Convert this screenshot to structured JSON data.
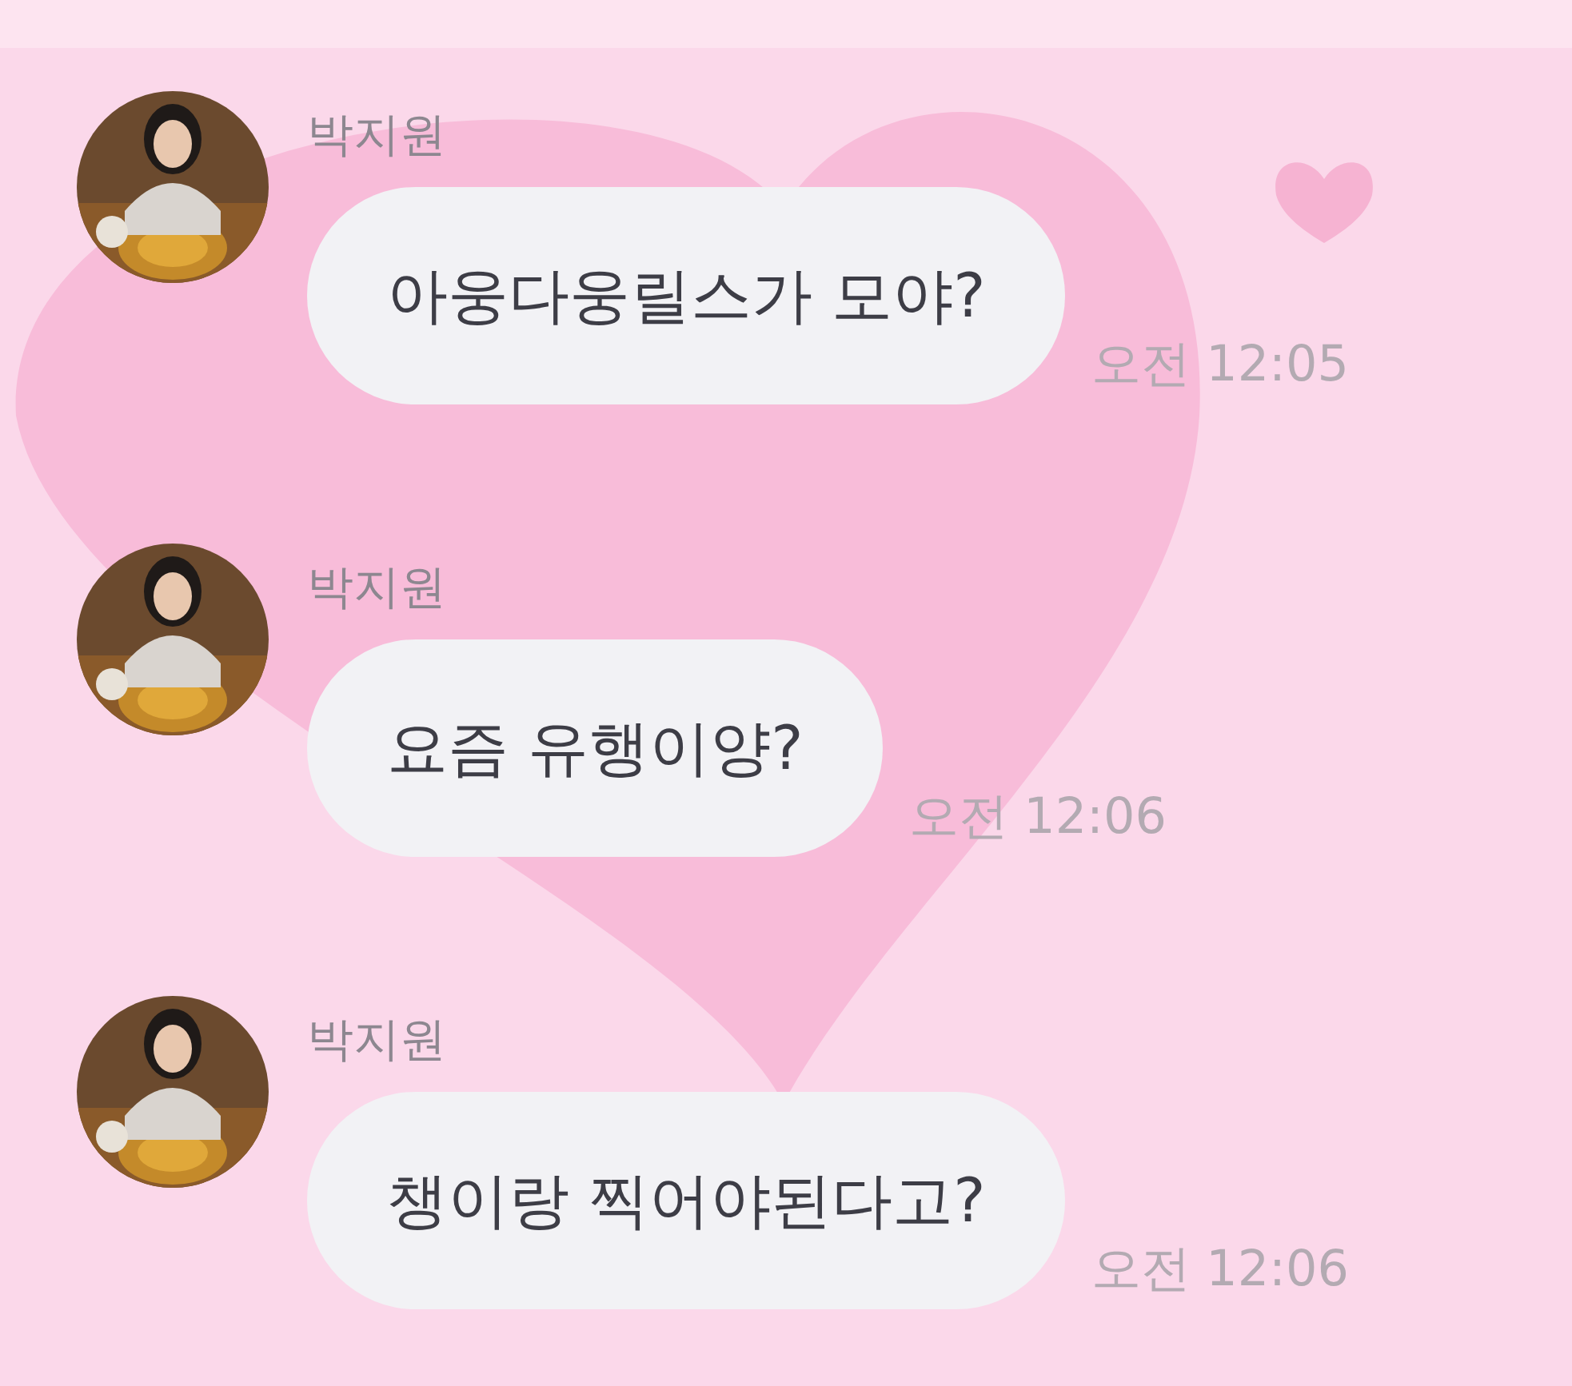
{
  "messages": [
    {
      "sender": "박지원",
      "text": "아웅다웅릴스가 모야?",
      "time": "오전 12:05"
    },
    {
      "sender": "박지원",
      "text": "요즘 유행이양?",
      "time": "오전 12:06"
    },
    {
      "sender": "박지원",
      "text": "챙이랑 찍어야된다고?",
      "time": "오전 12:06"
    }
  ]
}
